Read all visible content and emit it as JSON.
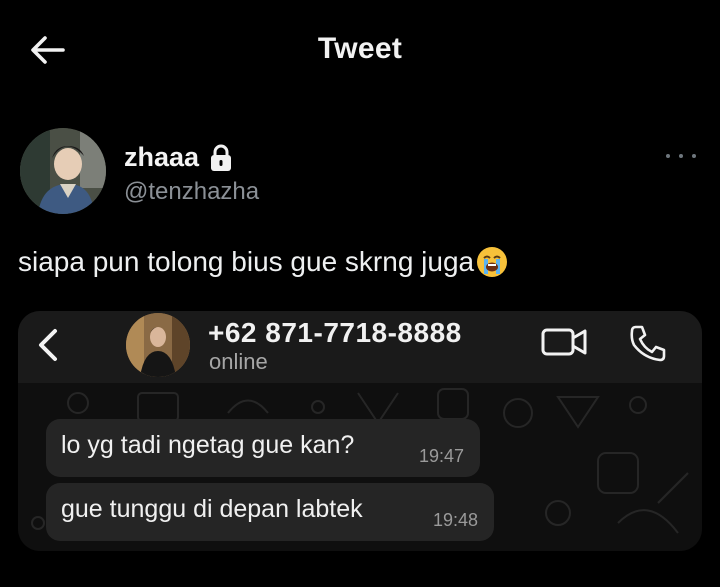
{
  "header": {
    "title": "Tweet",
    "back_icon": "arrow-left-icon"
  },
  "author": {
    "display_name": "zhaaa",
    "handle": "@tenzhazha",
    "protected_icon": "lock-icon",
    "more_icon": "more-horizontal-icon"
  },
  "tweet": {
    "text": "siapa pun tolong bius gue skrng juga",
    "emoji": "😭"
  },
  "chat": {
    "contact_number": "+62 871-7718-8888",
    "status": "online",
    "icons": [
      "chevron-left-icon",
      "video-call-icon",
      "phone-call-icon"
    ],
    "messages": [
      {
        "text": "lo yg tadi ngetag gue kan?",
        "time": "19:47"
      },
      {
        "text": "gue tunggu di depan labtek",
        "time": "19:48"
      }
    ]
  },
  "colors": {
    "background": "#000000",
    "text_primary": "#e7e9ea",
    "text_secondary": "#8b9096",
    "bubble": "#252525",
    "chat_header": "#1a1a1a"
  }
}
